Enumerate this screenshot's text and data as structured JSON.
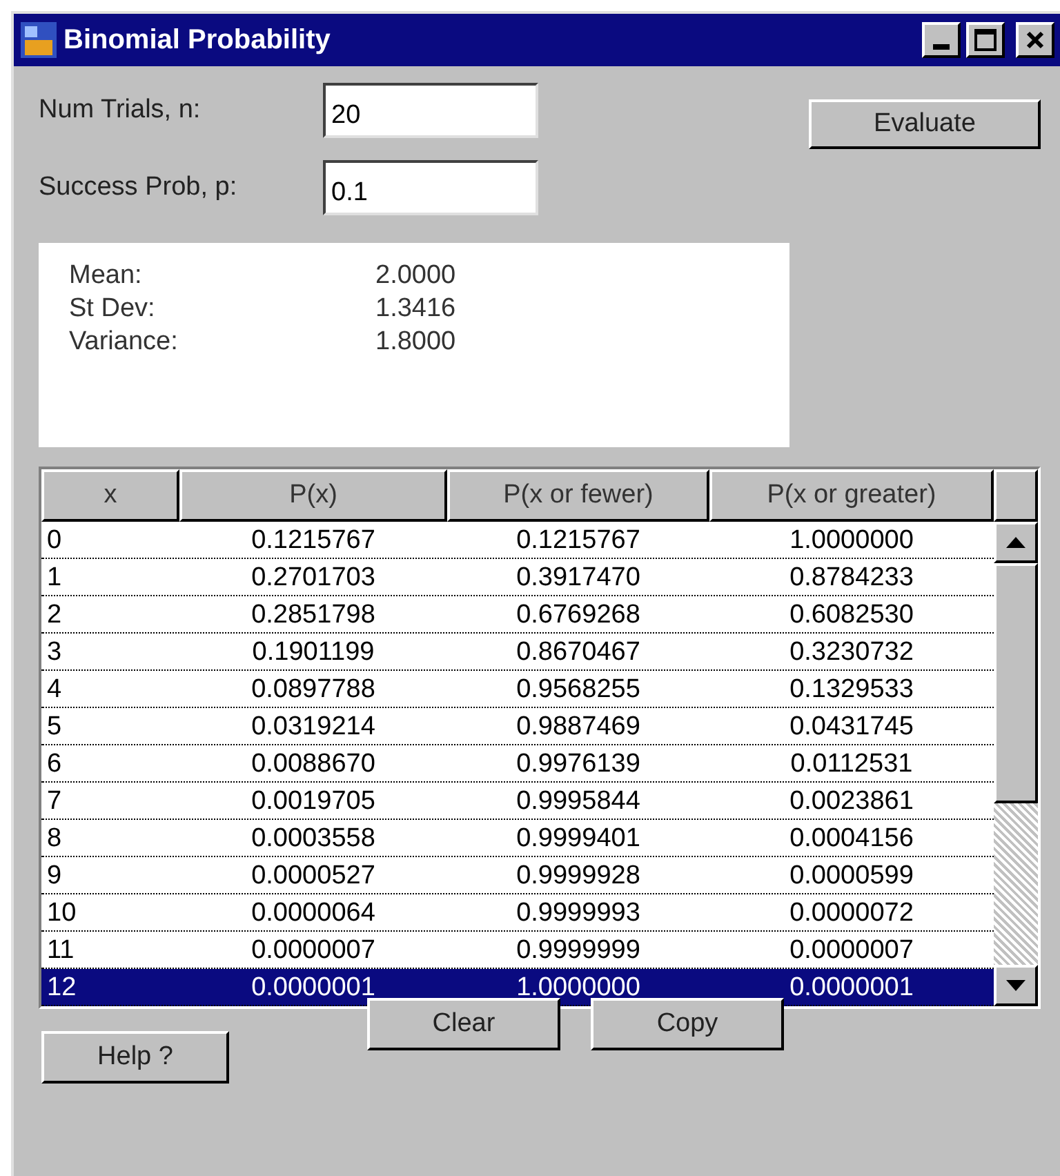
{
  "window": {
    "title": "Binomial Probability"
  },
  "inputs": [
    {
      "label": "Num Trials, n:",
      "value": "20"
    },
    {
      "label": "Success Prob, p:",
      "value": "0.1"
    }
  ],
  "evaluate_button": "Evaluate",
  "stats": [
    {
      "label": "Mean:",
      "value": "2.0000"
    },
    {
      "label": "St Dev:",
      "value": "1.3416"
    },
    {
      "label": "Variance:",
      "value": "1.8000"
    }
  ],
  "table": {
    "columns": [
      "x",
      "P(x)",
      "P(x or fewer)",
      "P(x or greater)"
    ],
    "rows": [
      {
        "cells": [
          "0",
          "0.1215767",
          "0.1215767",
          "1.0000000"
        ],
        "selected": false
      },
      {
        "cells": [
          "1",
          "0.2701703",
          "0.3917470",
          "0.8784233"
        ],
        "selected": false
      },
      {
        "cells": [
          "2",
          "0.2851798",
          "0.6769268",
          "0.6082530"
        ],
        "selected": false
      },
      {
        "cells": [
          "3",
          "0.1901199",
          "0.8670467",
          "0.3230732"
        ],
        "selected": false
      },
      {
        "cells": [
          "4",
          "0.0897788",
          "0.9568255",
          "0.1329533"
        ],
        "selected": false
      },
      {
        "cells": [
          "5",
          "0.0319214",
          "0.9887469",
          "0.0431745"
        ],
        "selected": false
      },
      {
        "cells": [
          "6",
          "0.0088670",
          "0.9976139",
          "0.0112531"
        ],
        "selected": false
      },
      {
        "cells": [
          "7",
          "0.0019705",
          "0.9995844",
          "0.0023861"
        ],
        "selected": false
      },
      {
        "cells": [
          "8",
          "0.0003558",
          "0.9999401",
          "0.0004156"
        ],
        "selected": false
      },
      {
        "cells": [
          "9",
          "0.0000527",
          "0.9999928",
          "0.0000599"
        ],
        "selected": false
      },
      {
        "cells": [
          "10",
          "0.0000064",
          "0.9999993",
          "0.0000072"
        ],
        "selected": false
      },
      {
        "cells": [
          "11",
          "0.0000007",
          "0.9999999",
          "0.0000007"
        ],
        "selected": false
      },
      {
        "cells": [
          "12",
          "0.0000001",
          "1.0000000",
          "0.0000001"
        ],
        "selected": true
      }
    ]
  },
  "action_buttons": [
    "Clear",
    "Copy"
  ],
  "help_button": "Help ?"
}
